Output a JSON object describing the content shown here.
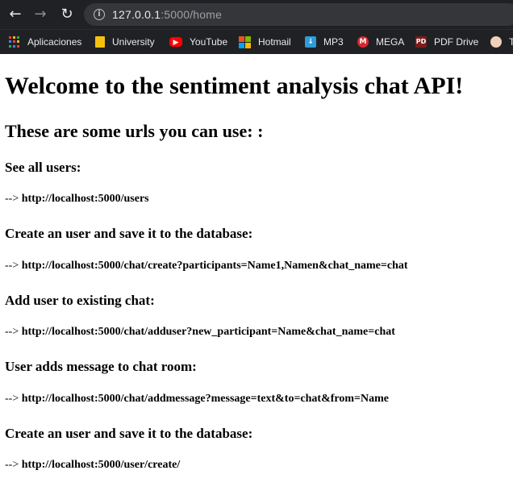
{
  "browser": {
    "url_host": "127.0.0.1",
    "url_path": ":5000/home",
    "nav": {
      "back": "←",
      "forward": "→",
      "reload": "↻"
    },
    "bookmarks": [
      {
        "label": "Aplicaciones",
        "icon": "apps-grid-icon"
      },
      {
        "label": "University",
        "icon": "folder-icon"
      },
      {
        "label": "YouTube",
        "icon": "youtube-icon"
      },
      {
        "label": "Hotmail",
        "icon": "microsoft-icon"
      },
      {
        "label": "MP3",
        "icon": "download-icon"
      },
      {
        "label": "MEGA",
        "icon": "mega-icon"
      },
      {
        "label": "PDF Drive",
        "icon": "pdf-drive-icon"
      },
      {
        "label": "T",
        "icon": "avatar-icon"
      }
    ]
  },
  "page": {
    "title": "Welcome to the sentiment analysis chat API!",
    "subtitle": "These are some urls you can use: :",
    "sections": [
      {
        "heading": "See all users:",
        "arrow": "-->",
        "url": "http://localhost:5000/users"
      },
      {
        "heading": "Create an user and save it to the database:",
        "arrow": "-->",
        "url": "http://localhost:5000/chat/create?participants=Name1,Namen&chat_name=chat"
      },
      {
        "heading": "Add user to existing chat:",
        "arrow": "-->",
        "url": "http://localhost:5000/chat/adduser?new_participant=Name&chat_name=chat"
      },
      {
        "heading": "User adds message to chat room:",
        "arrow": "-->",
        "url": "http://localhost:5000/chat/addmessage?message=text&to=chat&from=Name"
      },
      {
        "heading": "Create an user and save it to the database:",
        "arrow": "-->",
        "url": "http://localhost:5000/user/create/"
      }
    ]
  }
}
